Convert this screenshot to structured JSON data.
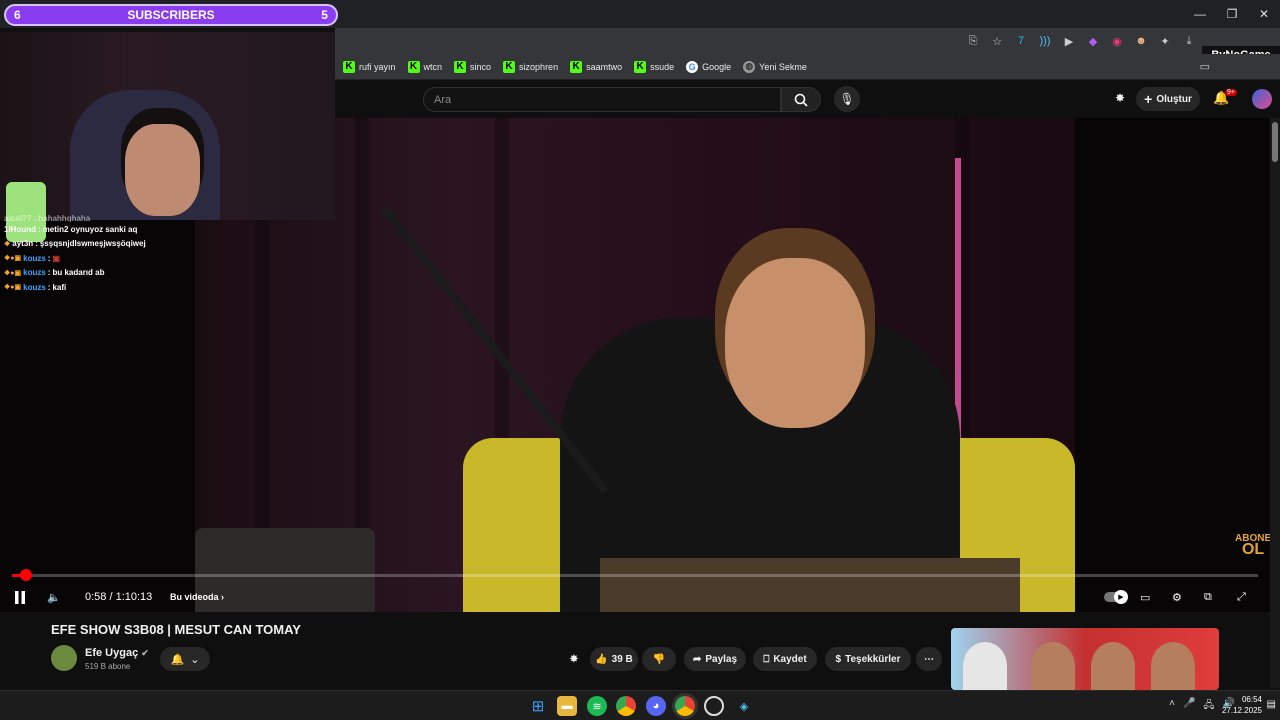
{
  "overlay": {
    "subs_left": "6",
    "subs_label": "SUBSCRIBERS",
    "subs_right": "5",
    "chat": [
      {
        "user": "aicel??",
        "msg": "hahahhqhaha",
        "blue": false,
        "badges": ""
      },
      {
        "user": "1lHound",
        "msg": "metin2 oynuyoz sanki aq",
        "blue": false,
        "badges": ""
      },
      {
        "user": "ayt3n",
        "msg": "şsşqsnjdlswmeşjwsşöqiwej",
        "blue": false,
        "badges": "❖"
      },
      {
        "user": "kouzs",
        "msg": "▣",
        "blue": true,
        "badges": "❖●▣"
      },
      {
        "user": "kouzs",
        "msg": "bu kadarıd ab",
        "blue": true,
        "badges": "❖●▣"
      },
      {
        "user": "kouzs",
        "msg": "kafi",
        "blue": true,
        "badges": "❖●▣"
      }
    ]
  },
  "browser": {
    "brand": "ByNoGame",
    "bookmarks": [
      {
        "label": "rufi yayın",
        "icon": "kick-icon"
      },
      {
        "label": "wtcn",
        "icon": "kick-icon"
      },
      {
        "label": "sinco",
        "icon": "kick-icon"
      },
      {
        "label": "sizophren",
        "icon": "kick-icon"
      },
      {
        "label": "saamtwo",
        "icon": "kick-icon"
      },
      {
        "label": "ssude",
        "icon": "kick-icon"
      },
      {
        "label": "Google",
        "icon": "google-icon"
      },
      {
        "label": "Yeni Sekme",
        "icon": "globe-icon"
      }
    ]
  },
  "youtube": {
    "search_placeholder": "Ara",
    "create_label": "Oluştur",
    "notif_badge": "9+",
    "video": {
      "time": "0:58 / 1:10:13",
      "chapter": "Bu videoda",
      "progress": 0.014,
      "abone_top": "ABONE",
      "abone_bottom": "OL"
    },
    "title": "EFE SHOW S3B08 | MESUT CAN TOMAY",
    "channel": "Efe Uygaç",
    "subs": "519 B abone",
    "likes": "39 B",
    "share": "Paylaş",
    "save": "Kaydet",
    "thanks": "Teşekkürler"
  },
  "taskbar": {
    "time": "06:54",
    "date": "27.12.2025"
  },
  "colors": {
    "subs_bar": "#8a3cf0",
    "kick_green": "#53fc18",
    "progress_red": "#ff0000"
  }
}
